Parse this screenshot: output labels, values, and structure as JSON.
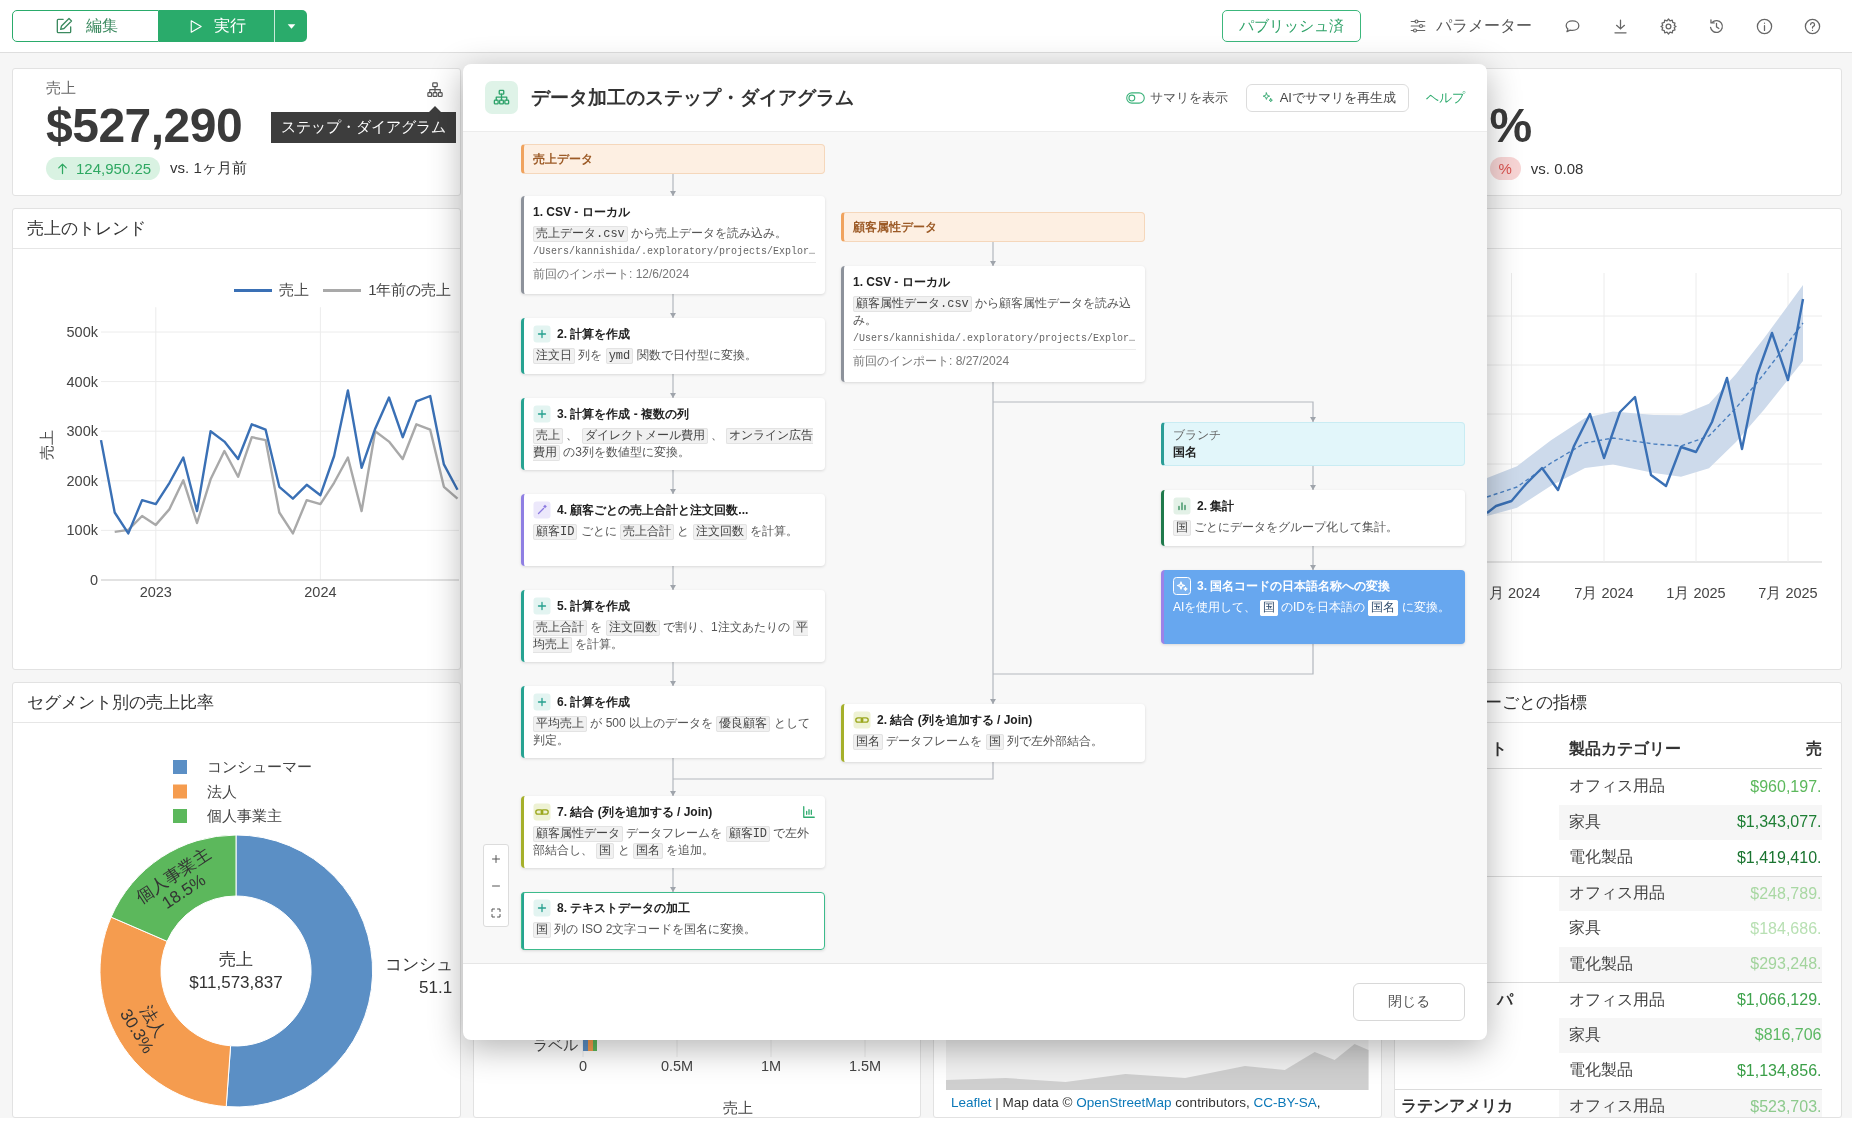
{
  "toolbar": {
    "edit_button": "編集",
    "run_button": "実行",
    "publish_status": "パブリッシュ済",
    "parameters_button": "パラメーター"
  },
  "kpis": [
    {
      "label": "売上",
      "value": "$527,290",
      "change": "124,950.25",
      "rising": true,
      "arrow": true,
      "comparison": "vs. 1ヶ月前",
      "tooltip": "ステップ・ダイアグラム"
    },
    {
      "value": "%",
      "change": "%",
      "rising": false,
      "arrow": false,
      "comparison": "vs. 0.08"
    }
  ],
  "trend_chart": {
    "title": "売上のトレンド",
    "chart_data": {
      "type": "line",
      "ylabel": "売上",
      "grid": true,
      "legend": "top-right",
      "x": [
        2022.667,
        2022.75,
        2022.833,
        2022.917,
        2023,
        2023.083,
        2023.167,
        2023.25,
        2023.333,
        2023.417,
        2023.5,
        2023.583,
        2023.667,
        2023.75,
        2023.833,
        2023.917,
        2024,
        2024.083,
        2024.167,
        2024.25,
        2024.333,
        2024.417,
        2024.5,
        2024.583,
        2024.667,
        2024.75,
        2024.833
      ],
      "xlim": [
        2022.667,
        2024.842
      ],
      "ylim": [
        0,
        550000
      ],
      "xticks": [
        {
          "value": 2023,
          "label": "2023"
        },
        {
          "value": 2024,
          "label": "2024"
        }
      ],
      "yticks": [
        {
          "value": 0,
          "label": "0"
        },
        {
          "value": 100000,
          "label": "100k"
        },
        {
          "value": 200000,
          "label": "200k"
        },
        {
          "value": 300000,
          "label": "300k"
        },
        {
          "value": 400000,
          "label": "400k"
        },
        {
          "value": 500000,
          "label": "500k"
        }
      ],
      "series": [
        {
          "name": "売上",
          "color": "#3a70b5",
          "values": [
            282000,
            136000,
            94000,
            161000,
            153000,
            196000,
            247000,
            139000,
            300000,
            279000,
            244000,
            314000,
            303000,
            188000,
            164000,
            192000,
            171000,
            250000,
            382000,
            226000,
            305000,
            368000,
            288000,
            360000,
            371000,
            233000,
            182000
          ]
        },
        {
          "name": "1年前の売上",
          "color": "#a9a9a9",
          "values": [
            null,
            97000,
            101000,
            129000,
            111000,
            143000,
            201000,
            115000,
            203000,
            260000,
            208000,
            288000,
            282000,
            136000,
            94000,
            161000,
            153000,
            196000,
            247000,
            139000,
            300000,
            279000,
            244000,
            314000,
            303000,
            188000,
            164000
          ]
        }
      ]
    }
  },
  "segment_chart": {
    "title": "セグメント別の売上比率",
    "center_label": "売上",
    "center_value": "$11,573,837",
    "slice_labels": [
      {
        "name": "コンシュ",
        "value": "51.1"
      },
      {
        "name": "法人",
        "value": "30.3%"
      },
      {
        "name": "個人事業主",
        "value": "18.5%"
      }
    ],
    "chart_data": {
      "type": "donut",
      "legend": "top",
      "categories": [
        "コンシューマー",
        "法人",
        "個人事業主"
      ],
      "values": [
        51.1,
        30.3,
        18.5
      ],
      "colors": [
        "#5b8fc5",
        "#f59c4f",
        "#5cb85c"
      ]
    }
  },
  "bar_chart": {
    "category": "ラベル",
    "xticks": [
      "0",
      "0.5M",
      "1M",
      "1.5M"
    ],
    "xlabel": "売上"
  },
  "map": {
    "attribution": [
      {
        "kind": "link",
        "text": "Leaflet"
      },
      {
        "kind": "text",
        "text": " | Map data © "
      },
      {
        "kind": "link",
        "text": "OpenStreetMap"
      },
      {
        "kind": "text",
        "text": " contributors, "
      },
      {
        "kind": "link",
        "text": "CC-BY-SA"
      },
      {
        "kind": "text",
        "text": ","
      }
    ]
  },
  "forecast_chart": {
    "axis_labels": [
      "月 2024",
      "7月 2024",
      "1月 2025",
      "7月 2025"
    ]
  },
  "metrics_table": {
    "title": "ーごとの指標",
    "columns": [
      "ト",
      "製品カテゴリー",
      "売"
    ],
    "groups": [
      {
        "rows": [
          {
            "category": "オフィス用品",
            "value": "$960,197.",
            "color": "#5cb85c"
          },
          {
            "category": "家具",
            "value": "$1,343,077.",
            "color": "#1e7e34"
          },
          {
            "category": "電化製品",
            "value": "$1,419,410.",
            "color": "#1a7430"
          }
        ]
      },
      {
        "rows": [
          {
            "category": "オフィス用品",
            "value": "$248,789.",
            "color": "#a9d8a3"
          },
          {
            "category": "家具",
            "value": "$184,686.",
            "color": "#b8e0b3"
          },
          {
            "category": "電化製品",
            "value": "$293,248.",
            "color": "#a3d49d"
          }
        ]
      },
      {
        "name": "パ",
        "rows": [
          {
            "category": "オフィス用品",
            "value": "$1,066,129.",
            "color": "#3fa34d"
          },
          {
            "category": "家具",
            "value": "$816,706",
            "color": "#5cb863"
          },
          {
            "category": "電化製品",
            "value": "$1,134,856.",
            "color": "#3a9e47"
          }
        ]
      },
      {
        "name": "ラテンアメリカ",
        "rows": [
          {
            "category": "オフィス用品",
            "value": "$523,703.",
            "color": "#8dca8d"
          }
        ]
      }
    ]
  },
  "diagram": {
    "title": "データ加工のステップ・ダイアグラム",
    "summary_toggle": {
      "label": "サマリを表示",
      "on": false
    },
    "regenerate_button": "AIでサマリを再生成",
    "help_link": "ヘルプ",
    "close_button": "閉じる",
    "main": {
      "source": "売上データ",
      "steps": [
        {
          "kind": "csv",
          "title": "1. CSV - ローカル",
          "description": [
            {
              "kind": "code",
              "text": "売上データ.csv"
            },
            {
              "kind": "text",
              "text": " から売上データを読み込み。"
            }
          ],
          "path": "/Users/kannishida/.exploratory/projects/Explor…",
          "imported": "前回のインポート: 12/6/2024",
          "selected": false,
          "highlighted": false,
          "chart": false
        },
        {
          "kind": "calc",
          "title": "2. 計算を作成",
          "description": [
            {
              "kind": "code",
              "text": "注文日"
            },
            {
              "kind": "text",
              "text": " 列を "
            },
            {
              "kind": "code",
              "text": "ymd"
            },
            {
              "kind": "text",
              "text": " 関数で日付型に変換。"
            }
          ],
          "selected": false,
          "highlighted": false,
          "chart": false
        },
        {
          "kind": "calc",
          "title": "3. 計算を作成 - 複数の列",
          "description": [
            {
              "kind": "code",
              "text": "売上"
            },
            {
              "kind": "text",
              "text": " 、 "
            },
            {
              "kind": "code",
              "text": "ダイレクトメール費用"
            },
            {
              "kind": "text",
              "text": " 、 "
            },
            {
              "kind": "code",
              "text": "オンライン広告費用"
            },
            {
              "kind": "text",
              "text": " の3列を数値型に変換。"
            }
          ],
          "selected": false,
          "highlighted": false,
          "chart": false
        },
        {
          "kind": "summarize",
          "title": "4. 顧客ごとの売上合計と注文回数...",
          "description": [
            {
              "kind": "code",
              "text": "顧客ID"
            },
            {
              "kind": "text",
              "text": " ごとに "
            },
            {
              "kind": "code",
              "text": "売上合計"
            },
            {
              "kind": "text",
              "text": " と "
            },
            {
              "kind": "code",
              "text": "注文回数"
            },
            {
              "kind": "text",
              "text": " を計算。"
            }
          ],
          "selected": false,
          "highlighted": false,
          "chart": false
        },
        {
          "kind": "calc",
          "title": "5. 計算を作成",
          "description": [
            {
              "kind": "code",
              "text": "売上合計"
            },
            {
              "kind": "text",
              "text": " を "
            },
            {
              "kind": "code",
              "text": "注文回数"
            },
            {
              "kind": "text",
              "text": " で割り、1注文あたりの "
            },
            {
              "kind": "code",
              "text": "平均売上"
            },
            {
              "kind": "text",
              "text": " を計算。"
            }
          ],
          "selected": false,
          "highlighted": false,
          "chart": false
        },
        {
          "kind": "calc",
          "title": "6. 計算を作成",
          "description": [
            {
              "kind": "code",
              "text": "平均売上"
            },
            {
              "kind": "text",
              "text": " が 500 以上のデータを "
            },
            {
              "kind": "code",
              "text": "優良顧客"
            },
            {
              "kind": "text",
              "text": " として判定。"
            }
          ],
          "selected": false,
          "highlighted": false,
          "chart": false
        },
        {
          "kind": "join",
          "title": "7. 結合 (列を追加する / Join)",
          "description": [
            {
              "kind": "code",
              "text": "顧客属性データ"
            },
            {
              "kind": "text",
              "text": " データフレームを "
            },
            {
              "kind": "code",
              "text": "顧客ID"
            },
            {
              "kind": "text",
              "text": " で左外部結合し、 "
            },
            {
              "kind": "code",
              "text": "国"
            },
            {
              "kind": "text",
              "text": " と "
            },
            {
              "kind": "code",
              "text": "国名"
            },
            {
              "kind": "text",
              "text": " を追加。"
            }
          ],
          "selected": false,
          "highlighted": false,
          "chart": true
        },
        {
          "kind": "calc",
          "title": "8. テキストデータの加工",
          "description": [
            {
              "kind": "code",
              "text": "国"
            },
            {
              "kind": "text",
              "text": " 列の ISO 2文字コードを国名に変換。"
            }
          ],
          "selected": true,
          "highlighted": false,
          "chart": false
        }
      ]
    },
    "sub": {
      "source": "顧客属性データ",
      "steps": [
        {
          "kind": "csv",
          "title": "1. CSV - ローカル",
          "description": [
            {
              "kind": "code",
              "text": "顧客属性データ.csv"
            },
            {
              "kind": "text",
              "text": " から顧客属性データを読み込み。"
            }
          ],
          "path": "/Users/kannishida/.exploratory/projects/Explor…",
          "imported": "前回のインポート: 8/27/2024",
          "selected": false,
          "highlighted": false,
          "chart": false
        },
        {
          "kind": "join",
          "title": "2. 結合 (列を追加する / Join)",
          "description": [
            {
              "kind": "code",
              "text": "国名"
            },
            {
              "kind": "text",
              "text": " データフレームを "
            },
            {
              "kind": "code",
              "text": "国"
            },
            {
              "kind": "text",
              "text": " 列で左外部結合。"
            }
          ],
          "selected": false,
          "highlighted": false,
          "chart": false
        }
      ]
    },
    "branch": {
      "label": "ブランチ",
      "name": "国名",
      "steps": [
        {
          "kind": "group",
          "title": "2. 集計",
          "description": [
            {
              "kind": "code",
              "text": "国"
            },
            {
              "kind": "text",
              "text": " ごとにデータをグループ化して集計。"
            }
          ],
          "selected": false,
          "highlighted": false,
          "chart": false
        },
        {
          "kind": "ai",
          "title": "3. 国名コードの日本語名称への変換",
          "description": [
            {
              "kind": "text",
              "text": "AIを使用して、 "
            },
            {
              "kind": "code",
              "text": "国"
            },
            {
              "kind": "text",
              "text": " のIDを日本語の "
            },
            {
              "kind": "code",
              "text": "国名"
            },
            {
              "kind": "text",
              "text": " に変換。"
            }
          ],
          "selected": false,
          "highlighted": true,
          "chart": false
        }
      ]
    }
  }
}
